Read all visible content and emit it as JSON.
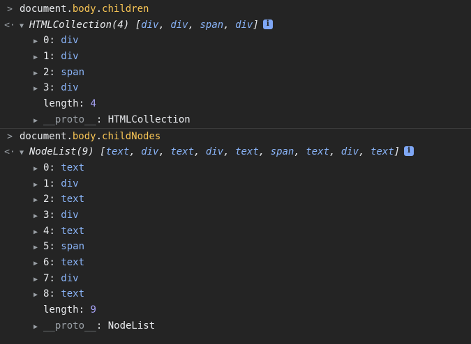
{
  "entries": [
    {
      "input": {
        "prompt": ">",
        "object": "document",
        "dot1": ".",
        "prop1": "body",
        "dot2": ".",
        "prop2": "children"
      },
      "result": {
        "return_marker": "<·",
        "expand_arrow": "▼",
        "type": "HTMLCollection(4)",
        "preview_open": "[",
        "preview_items": [
          "div",
          "div",
          "span",
          "div"
        ],
        "preview_close": "]",
        "items": [
          {
            "key": "0",
            "value": "div"
          },
          {
            "key": "1",
            "value": "div"
          },
          {
            "key": "2",
            "value": "span"
          },
          {
            "key": "3",
            "value": "div"
          }
        ],
        "length_key": "length",
        "length_value": "4",
        "proto_key": "__proto__",
        "proto_value": "HTMLCollection"
      }
    },
    {
      "input": {
        "prompt": ">",
        "object": "document",
        "dot1": ".",
        "prop1": "body",
        "dot2": ".",
        "prop2": "childNodes"
      },
      "result": {
        "return_marker": "<·",
        "expand_arrow": "▼",
        "type": "NodeList(9)",
        "preview_open": "[",
        "preview_items": [
          "text",
          "div",
          "text",
          "div",
          "text",
          "span",
          "text",
          "div",
          "text"
        ],
        "preview_close": "]",
        "items": [
          {
            "key": "0",
            "value": "text"
          },
          {
            "key": "1",
            "value": "div"
          },
          {
            "key": "2",
            "value": "text"
          },
          {
            "key": "3",
            "value": "div"
          },
          {
            "key": "4",
            "value": "text"
          },
          {
            "key": "5",
            "value": "span"
          },
          {
            "key": "6",
            "value": "text"
          },
          {
            "key": "7",
            "value": "div"
          },
          {
            "key": "8",
            "value": "text"
          }
        ],
        "length_key": "length",
        "length_value": "9",
        "proto_key": "__proto__",
        "proto_value": "NodeList"
      }
    }
  ],
  "colors": {
    "background": "#242424",
    "text": "#e8eaed",
    "object_value": "#8ab4f8",
    "input_property": "#f8c555",
    "number": "#a8a4f8",
    "muted": "#9aa0a6",
    "info_badge": "#7fa7f5"
  },
  "icons": {
    "collapsed_arrow": "▶",
    "info_badge": "info-icon"
  }
}
